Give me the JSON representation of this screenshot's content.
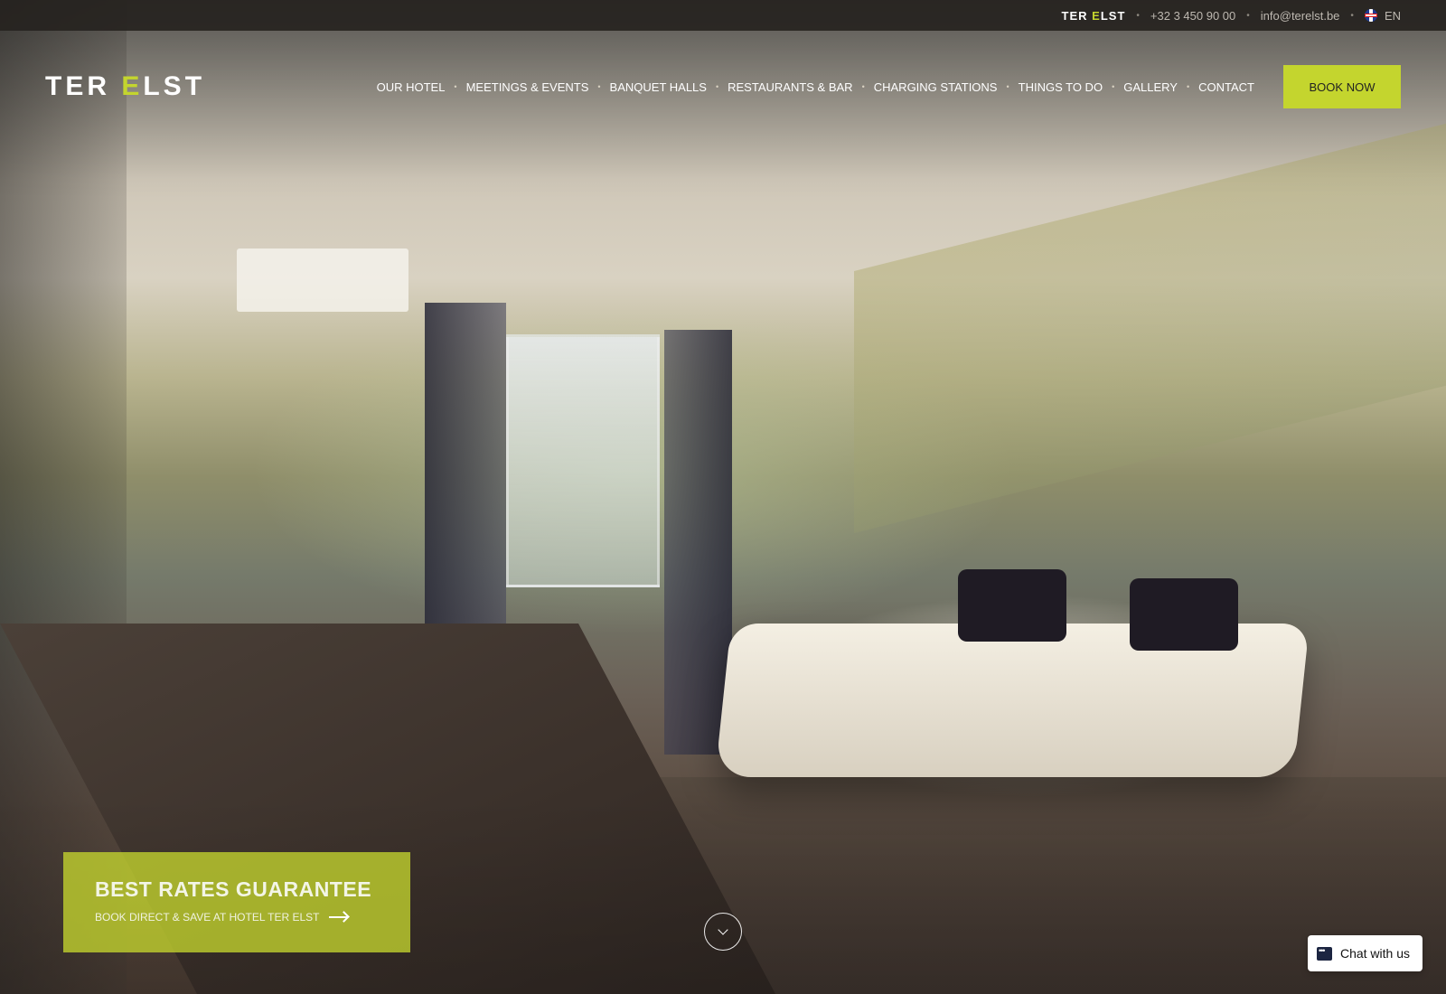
{
  "topbar": {
    "brand_left": "TER ",
    "brand_accent": "E",
    "brand_right": "LST",
    "phone": "+32 3 450 90 00",
    "email": "info@terelst.be",
    "language": "EN"
  },
  "logo": {
    "left": "TER ",
    "accent": "E",
    "right": "LST"
  },
  "nav": {
    "items": [
      {
        "label": "OUR HOTEL"
      },
      {
        "label": "MEETINGS & EVENTS"
      },
      {
        "label": "BANQUET HALLS"
      },
      {
        "label": "RESTAURANTS & BAR"
      },
      {
        "label": "CHARGING STATIONS"
      },
      {
        "label": "THINGS TO DO"
      },
      {
        "label": "GALLERY"
      },
      {
        "label": "CONTACT"
      }
    ],
    "book_label": "BOOK NOW"
  },
  "promo": {
    "title": "BEST RATES GUARANTEE",
    "subtitle": "BOOK DIRECT & SAVE AT HOTEL TER ELST"
  },
  "chat": {
    "label": "Chat with us"
  },
  "colors": {
    "accent": "#c4d52e",
    "topbar_bg": "#26231f",
    "chat_icon": "#1c2541"
  }
}
